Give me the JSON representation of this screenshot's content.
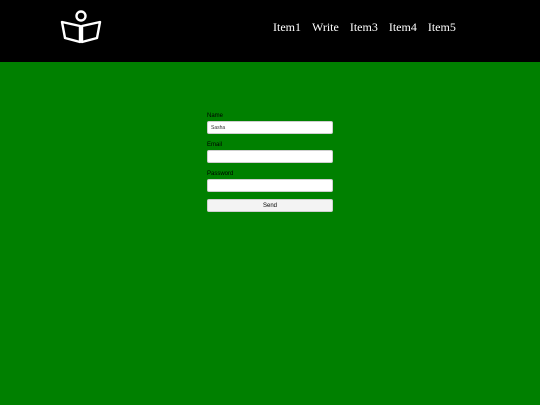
{
  "header": {
    "logo_icon": "open-book-reader-icon",
    "background": "#000000",
    "nav": [
      "Item1",
      "Write",
      "Item3",
      "Item4",
      "Item5"
    ]
  },
  "main": {
    "background": "#008000"
  },
  "form": {
    "name_label": "Name",
    "name_value": "Sasha",
    "email_label": "Email",
    "email_value": "",
    "password_label": "Password",
    "password_value": "",
    "send_label": "Send"
  }
}
